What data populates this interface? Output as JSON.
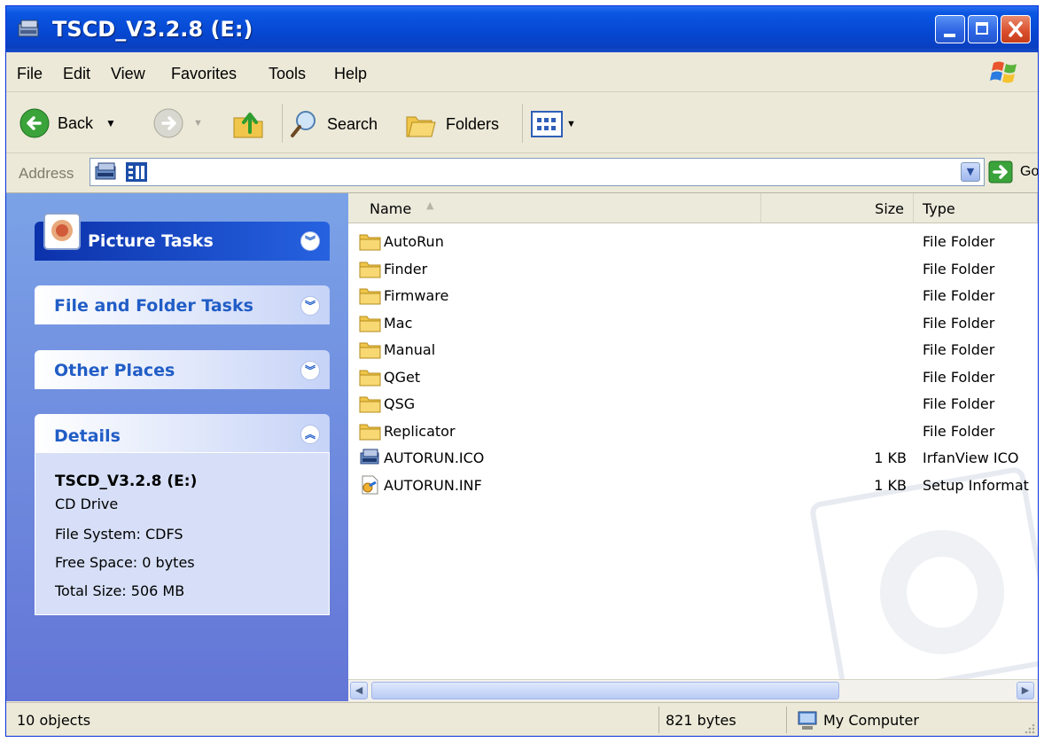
{
  "window": {
    "title": "TSCD_V3.2.8 (E:)"
  },
  "menu": [
    "File",
    "Edit",
    "View",
    "Favorites",
    "Tools",
    "Help"
  ],
  "toolbar": {
    "back": "Back",
    "search": "Search",
    "folders": "Folders"
  },
  "address": {
    "label": "Address",
    "go": "Go"
  },
  "tasks": {
    "picture": "Picture Tasks",
    "file_folder": "File and Folder Tasks",
    "other": "Other Places",
    "details": "Details"
  },
  "details": {
    "name": "TSCD_V3.2.8 (E:)",
    "type": "CD Drive",
    "fs": "File System: CDFS",
    "free": "Free Space: 0 bytes",
    "total": "Total Size: 506 MB"
  },
  "columns": {
    "name": "Name",
    "size": "Size",
    "type": "Type"
  },
  "files": [
    {
      "name": "AutoRun",
      "size": "",
      "type": "File Folder",
      "icon": "folder-icon"
    },
    {
      "name": "Finder",
      "size": "",
      "type": "File Folder",
      "icon": "folder-icon"
    },
    {
      "name": "Firmware",
      "size": "",
      "type": "File Folder",
      "icon": "folder-icon"
    },
    {
      "name": "Mac",
      "size": "",
      "type": "File Folder",
      "icon": "folder-icon"
    },
    {
      "name": "Manual",
      "size": "",
      "type": "File Folder",
      "icon": "folder-icon"
    },
    {
      "name": "QGet",
      "size": "",
      "type": "File Folder",
      "icon": "folder-icon"
    },
    {
      "name": "QSG",
      "size": "",
      "type": "File Folder",
      "icon": "folder-icon"
    },
    {
      "name": "Replicator",
      "size": "",
      "type": "File Folder",
      "icon": "folder-icon"
    },
    {
      "name": "AUTORUN.ICO",
      "size": "1 KB",
      "type": "IrfanView ICO",
      "icon": "ico-file-icon"
    },
    {
      "name": "AUTORUN.INF",
      "size": "1 KB",
      "type": "Setup Informat",
      "icon": "inf-file-icon"
    }
  ],
  "status": {
    "objects": "10 objects",
    "bytes": "821 bytes",
    "location": "My Computer"
  },
  "colors": {
    "title_blue": "#0a56e2",
    "task_blue": "#215dc6",
    "pane_blue": "#6b8be0"
  }
}
